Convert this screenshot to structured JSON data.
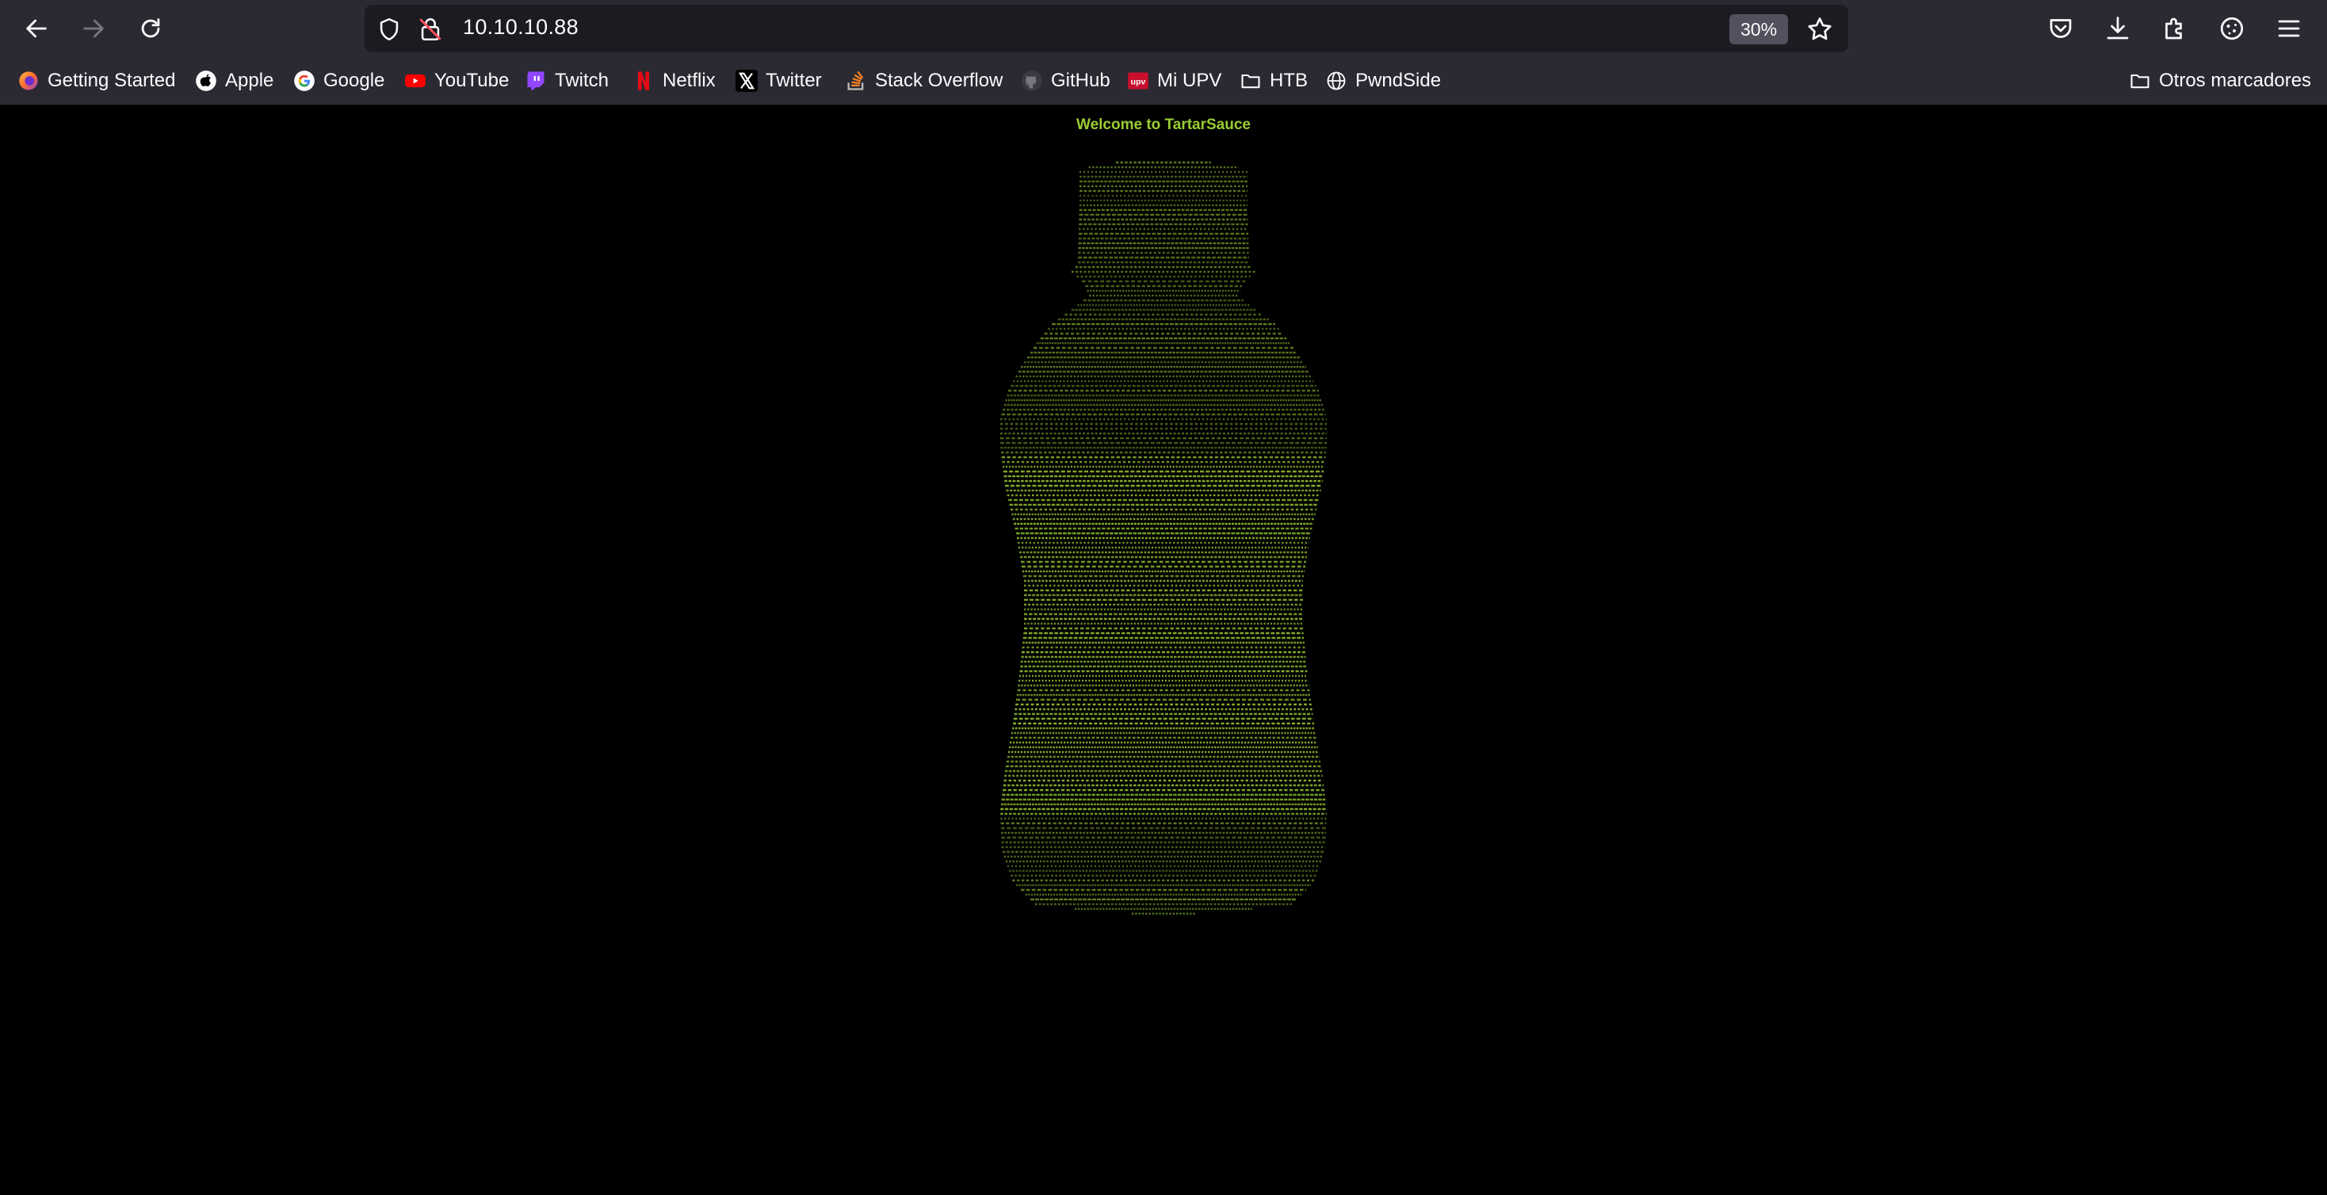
{
  "browser": {
    "url": "10.10.10.88",
    "zoom": "30%"
  },
  "bookmarks": [
    {
      "label": "Getting Started",
      "icon": "firefox-icon"
    },
    {
      "label": "Apple",
      "icon": "apple-icon"
    },
    {
      "label": "Google",
      "icon": "google-icon"
    },
    {
      "label": "YouTube",
      "icon": "youtube-icon"
    },
    {
      "label": "Twitch",
      "icon": "twitch-icon"
    },
    {
      "label": "Netflix",
      "icon": "netflix-icon"
    },
    {
      "label": "Twitter",
      "icon": "x-icon"
    },
    {
      "label": "Stack Overflow",
      "icon": "stackoverflow-icon"
    },
    {
      "label": "GitHub",
      "icon": "github-icon"
    },
    {
      "label": "Mi UPV",
      "icon": "upv-icon"
    },
    {
      "label": "HTB",
      "icon": "folder-icon"
    },
    {
      "label": "PwndSide",
      "icon": "globe-icon"
    }
  ],
  "other_bookmarks": "Otros marcadores",
  "page": {
    "heading": "Welcome to TartarSauce",
    "text_color": "#9acd32",
    "background": "#000000"
  }
}
